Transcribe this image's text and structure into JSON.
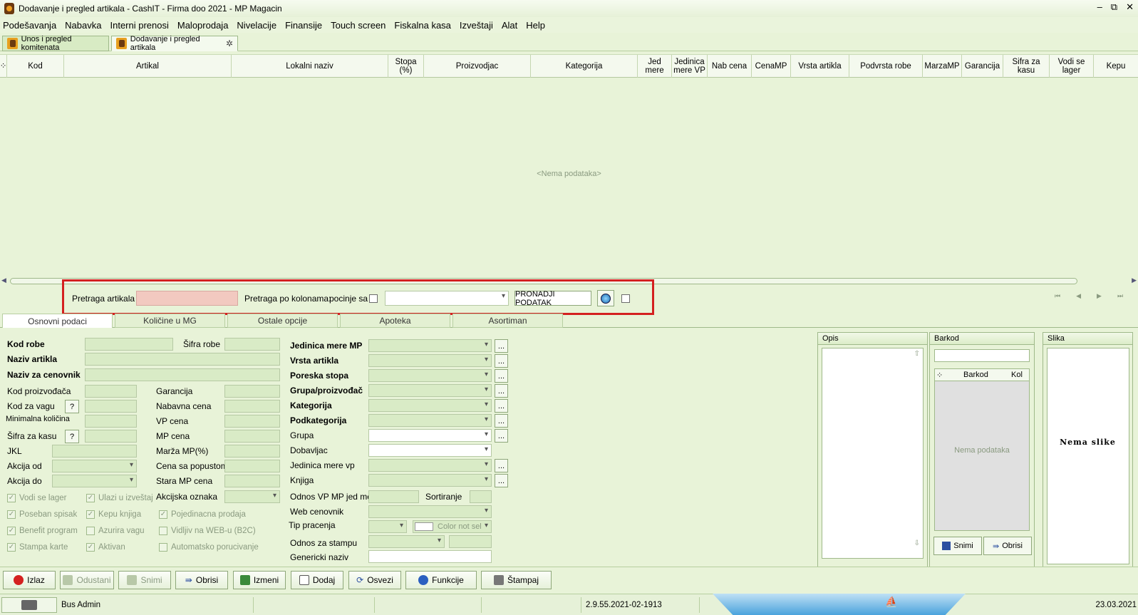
{
  "window": {
    "title": "Dodavanje i pregled artikala - CashIT - Firma doo 2021 - MP Magacin",
    "buttons": [
      "–",
      "⧉",
      "✕"
    ]
  },
  "menu": [
    "Podešavanja",
    "Nabavka",
    "Interni prenosi",
    "Maloprodaja",
    "Nivelacije",
    "Finansije",
    "Touch screen",
    "Fiskalna kasa",
    "Izveštaji",
    "Alat",
    "Help"
  ],
  "doc_tabs": [
    {
      "label": "Unos i pregled komitenata"
    },
    {
      "label": "Dodavanje i pregled artikala"
    }
  ],
  "grid": {
    "columns": [
      "Kod",
      "Artikal",
      "Lokalni naziv",
      "Stopa (%)",
      "Proizvodjac",
      "Kategorija",
      "Jed mere",
      "Jedinica mere VP",
      "Nab cena",
      "CenaMP",
      "Vrsta artikla",
      "Podvrsta robe",
      "MarzaMP",
      "Garancija",
      "Sifra za kasu",
      "Vodi se lager",
      "Kepu"
    ],
    "empty_text": "<Nema podataka>"
  },
  "search": {
    "label": "Pretraga artikala",
    "columns_label": "Pretraga po kolonama:",
    "starts_with_label": "pocinje sa",
    "find_button": "PRONADJI PODATAK"
  },
  "sub_tabs": [
    "Osnovni podaci",
    "Količine u MG",
    "Ostale opcije",
    "Apoteka",
    "Asortiman"
  ],
  "form": {
    "kod_robe": "Kod robe",
    "sifra_robe": "Šifra robe",
    "naziv_artikla": "Naziv artikla",
    "naziv_cenovnik": "Naziv za cenovnik",
    "kod_proizvodjaca": "Kod proizvođača",
    "garancija": "Garancija",
    "kod_za_vagu": "Kod za vagu",
    "nabavna_cena": "Nabavna cena",
    "minimalna_kolicina": "Minimalna količina",
    "vp_cena": "VP cena",
    "sifra_za_kasu": "Šifra za kasu",
    "mp_cena": "MP cena",
    "jkl": "JKL",
    "marza_mp": "Marža MP(%)",
    "akcija_od": "Akcija od",
    "cena_sa_popustom": "Cena sa popustom",
    "akcija_do": "Akcija do",
    "stara_mp_cena": "Stara MP cena",
    "akcijska_oznaka": "Akcijska oznaka",
    "q_mark": "?",
    "jedinica_mere_mp": "Jedinica mere MP",
    "vrsta_artikla": "Vrsta artikla",
    "poreska_stopa": "Poreska stopa",
    "grupa_proizvodjac": "Grupa/proizvođač",
    "kategorija": "Kategorija",
    "podkategorija": "Podkategorija",
    "grupa": "Grupa",
    "dobavljac": "Dobavljac",
    "jedinica_mere_vp": "Jedinica mere vp",
    "knjiga": "Knjiga",
    "odnos_vp_mp": "Odnos VP MP jed mere",
    "sortiranje": "Sortiranje",
    "web_cenovnik": "Web cenovnik",
    "tip_pracenja": "Tip pracenja",
    "color_not_sel": "Color not sel",
    "odnos_za_stampu": "Odnos za stampu",
    "genericki_naziv": "Genericki naziv",
    "dots": "..."
  },
  "checkboxes": [
    {
      "label": "Vodi se lager",
      "checked": true
    },
    {
      "label": "Ulazi u izveštaj",
      "checked": true
    },
    {
      "label": "Poseban spisak",
      "checked": true
    },
    {
      "label": "Kepu knjiga",
      "checked": true
    },
    {
      "label": "Pojedinacna prodaja",
      "checked": true
    },
    {
      "label": "Benefit program",
      "checked": true
    },
    {
      "label": "Azurira vagu",
      "checked": false
    },
    {
      "label": "Vidljiv na WEB-u (B2C)",
      "checked": false
    },
    {
      "label": "Stampa karte",
      "checked": true
    },
    {
      "label": "Aktivan",
      "checked": true
    },
    {
      "label": "Automatsko porucivanje",
      "checked": false
    }
  ],
  "panels": {
    "opis": "Opis",
    "barkod": "Barkod",
    "barkod_cols": [
      "Barkod",
      "Kol"
    ],
    "barkod_empty": "Nema podataka",
    "snimi": "Snimi",
    "obrisi": "Obrisi",
    "slika": "Slika",
    "slika_empty": "Nema slike"
  },
  "footer_buttons": [
    "Izlaz",
    "Odustani",
    "Snimi",
    "Obrisi",
    "Izmeni",
    "Dodaj",
    "Osvezi",
    "Funkcije",
    "Štampaj"
  ],
  "status": {
    "user": "Bus Admin",
    "version": "2.9.55.2021-02-1913",
    "date": "23.03.2021"
  },
  "colors": {
    "bg": "#e8f3d8",
    "highlight": "#d42020",
    "pink": "#f2c9c0"
  }
}
